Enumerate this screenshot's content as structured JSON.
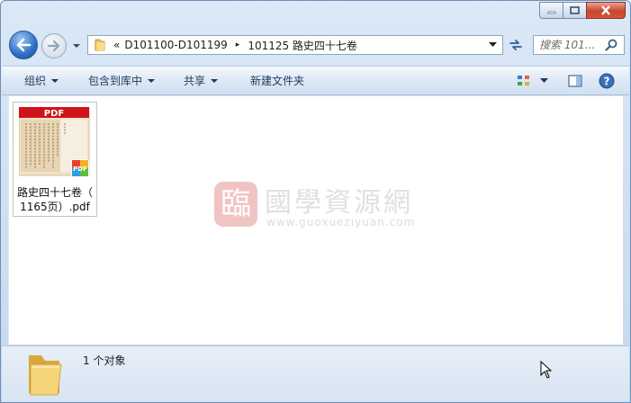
{
  "window": {
    "buttons": {
      "minimize": "minimize",
      "maximize": "maximize",
      "close": "close"
    }
  },
  "nav": {
    "overflow": "«",
    "breadcrumb": [
      "D101100-D101199",
      "101125 路史四十七卷"
    ],
    "separator": "▸",
    "search_placeholder": "搜索 101..."
  },
  "toolbar": {
    "organize": "组织",
    "include_library": "包含到库中",
    "share": "共享",
    "new_folder": "新建文件夹"
  },
  "files": [
    {
      "name_line1": "路史四十七卷（",
      "name_line2": "1165页）.pdf",
      "thumb_banner": "PDF",
      "badge": "PDF"
    }
  ],
  "watermark": {
    "seal": "臨",
    "title": "國學資源網",
    "url": "www.guoxueziyuan.com"
  },
  "status": {
    "count_text": "1 个对象"
  },
  "colors": {
    "accent": "#2d6fc7",
    "pdf_red": "#d0121b",
    "close_red": "#c7452e"
  }
}
